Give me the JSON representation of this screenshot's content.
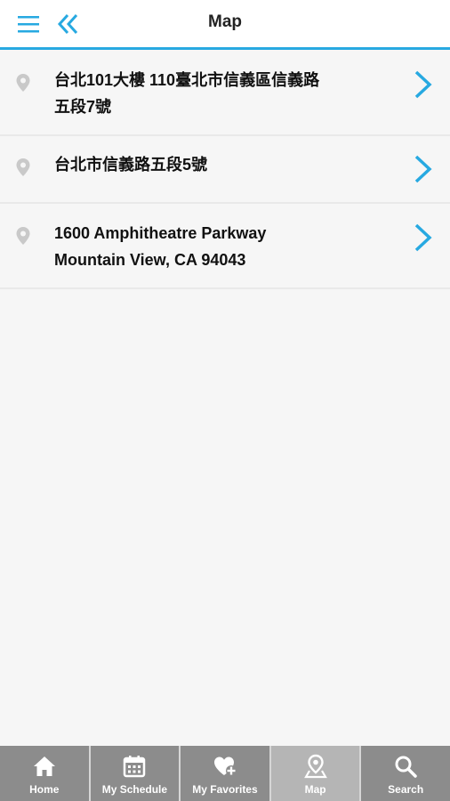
{
  "header": {
    "title": "Map",
    "menu_icon": "hamburger-icon",
    "back_icon": "double-chevron-left-icon",
    "accent_color": "#27a9e1"
  },
  "locations": [
    {
      "line1": "台北101大樓 110臺北市信義區信義路",
      "line2": "五段7號"
    },
    {
      "line1": "台北市信義路五段5號",
      "line2": ""
    },
    {
      "line1": "1600 Amphitheatre Parkway",
      "line2": "Mountain View, CA 94043"
    }
  ],
  "tabbar": {
    "tabs": [
      {
        "label": "Home",
        "icon": "home-icon",
        "active": false
      },
      {
        "label": "My Schedule",
        "icon": "calendar-icon",
        "active": false
      },
      {
        "label": "My Favorites",
        "icon": "heart-plus-icon",
        "active": false
      },
      {
        "label": "Map",
        "icon": "map-pin-icon",
        "active": true
      },
      {
        "label": "Search",
        "icon": "search-icon",
        "active": false
      }
    ],
    "bg_color": "#8c8c8c",
    "active_bg_color": "#b5b5b5"
  }
}
